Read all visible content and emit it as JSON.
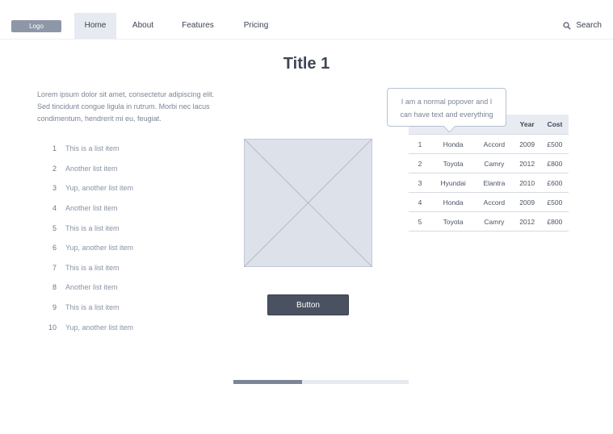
{
  "nav": {
    "logo": "Logo",
    "items": [
      {
        "label": "Home",
        "active": true
      },
      {
        "label": "About",
        "active": false
      },
      {
        "label": "Features",
        "active": false
      },
      {
        "label": "Pricing",
        "active": false
      }
    ],
    "search_label": "Search",
    "search_icon": "search-icon"
  },
  "title": "Title 1",
  "paragraph": "Lorem ipsum dolor sit amet, consectetur adipiscing elit. Sed tincidunt congue ligula in rutrum. Morbi nec lacus condimentum, hendrerit mi eu, feugiat.",
  "list": [
    {
      "num": "1",
      "text": "This is a list item"
    },
    {
      "num": "2",
      "text": "Another list item"
    },
    {
      "num": "3",
      "text": "Yup, another list item"
    },
    {
      "num": "4",
      "text": "Another list item"
    },
    {
      "num": "5",
      "text": "This is a list item"
    },
    {
      "num": "6",
      "text": "Yup, another list item"
    },
    {
      "num": "7",
      "text": "This is a list item"
    },
    {
      "num": "8",
      "text": "Another list item"
    },
    {
      "num": "9",
      "text": "This is a list item"
    },
    {
      "num": "10",
      "text": "Yup, another list item"
    }
  ],
  "image_placeholder_icon": "image-placeholder-icon",
  "button_label": "Button",
  "progress_fraction": 0.39,
  "popover": {
    "line1": "I am a normal popover and I",
    "line2": "can have text and everything"
  },
  "table": {
    "headers": [
      "",
      "",
      "",
      "Year",
      "Cost"
    ],
    "rows": [
      [
        "1",
        "Honda",
        "Accord",
        "2009",
        "£500"
      ],
      [
        "2",
        "Toyota",
        "Camry",
        "2012",
        "£800"
      ],
      [
        "3",
        "Hyundai",
        "Elantra",
        "2010",
        "£600"
      ],
      [
        "4",
        "Honda",
        "Accord",
        "2009",
        "£500"
      ],
      [
        "5",
        "Toyota",
        "Camry",
        "2012",
        "£800"
      ]
    ]
  },
  "colors": {
    "accent_dark": "#4a5160",
    "active_nav_bg": "#e6eaf1",
    "placeholder_bg": "#dde2ea"
  }
}
